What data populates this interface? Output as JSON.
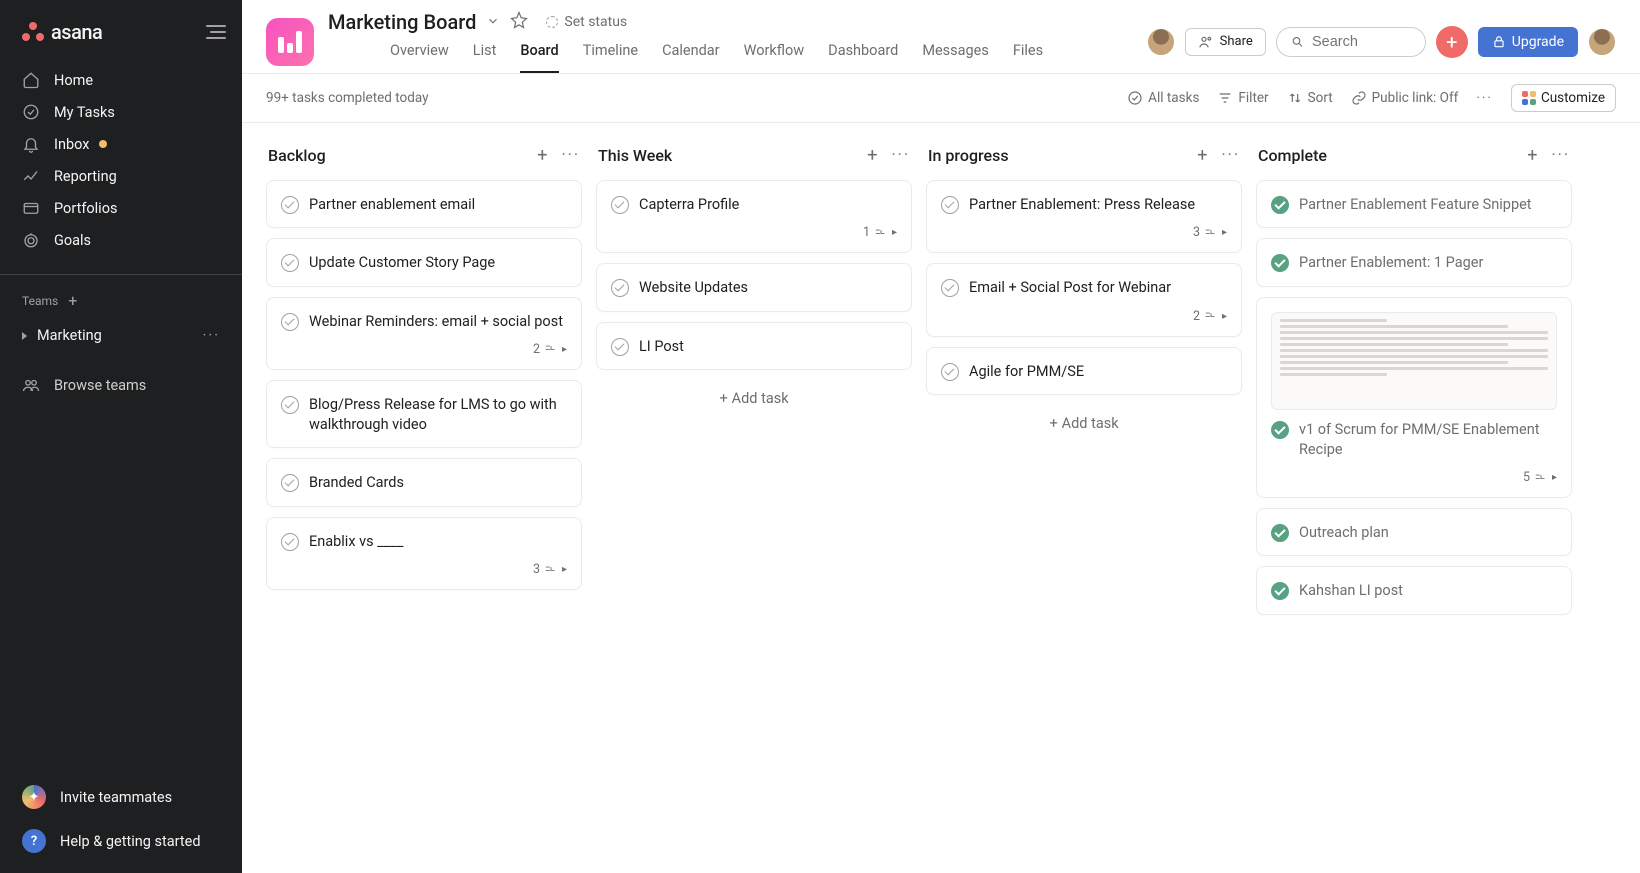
{
  "sidebar": {
    "nav": [
      {
        "label": "Home",
        "icon": "home-icon"
      },
      {
        "label": "My Tasks",
        "icon": "check-circle-icon"
      },
      {
        "label": "Inbox",
        "icon": "bell-icon",
        "dot": true
      },
      {
        "label": "Reporting",
        "icon": "chart-icon"
      },
      {
        "label": "Portfolios",
        "icon": "folder-icon"
      },
      {
        "label": "Goals",
        "icon": "target-icon"
      }
    ],
    "teams_label": "Teams",
    "team_name": "Marketing",
    "browse": "Browse teams",
    "invite": "Invite teammates",
    "help": "Help & getting started"
  },
  "header": {
    "title": "Marketing Board",
    "set_status": "Set status",
    "share": "Share",
    "search_placeholder": "Search",
    "upgrade": "Upgrade",
    "tabs": [
      "Overview",
      "List",
      "Board",
      "Timeline",
      "Calendar",
      "Workflow",
      "Dashboard",
      "Messages",
      "Files"
    ],
    "active_tab": "Board"
  },
  "toolbar": {
    "completed_text": "99+ tasks completed today",
    "all_tasks": "All tasks",
    "filter": "Filter",
    "sort": "Sort",
    "public": "Public link: Off",
    "customize": "Customize"
  },
  "columns": [
    {
      "name": "Backlog",
      "cards": [
        {
          "title": "Partner enablement email",
          "done": false
        },
        {
          "title": "Update Customer Story Page",
          "done": false
        },
        {
          "title": "Webinar Reminders: email + social post",
          "done": false,
          "subtasks": 2
        },
        {
          "title": "Blog/Press Release for LMS to go with walkthrough video",
          "done": false
        },
        {
          "title": "Branded Cards",
          "done": false
        },
        {
          "title": "Enablix vs ____",
          "done": false,
          "subtasks": 3
        }
      ]
    },
    {
      "name": "This Week",
      "cards": [
        {
          "title": "Capterra Profile",
          "done": false,
          "subtasks": 1
        },
        {
          "title": "Website Updates",
          "done": false
        },
        {
          "title": "LI Post",
          "done": false
        }
      ],
      "show_add": true
    },
    {
      "name": "In progress",
      "cards": [
        {
          "title": "Partner Enablement: Press Release",
          "done": false,
          "subtasks": 3
        },
        {
          "title": "Email + Social Post for Webinar",
          "done": false,
          "subtasks": 2
        },
        {
          "title": "Agile for PMM/SE",
          "done": false
        }
      ],
      "show_add": true
    },
    {
      "name": "Complete",
      "cards": [
        {
          "title": "Partner Enablement Feature Snippet",
          "done": true
        },
        {
          "title": "Partner Enablement: 1 Pager",
          "done": true
        },
        {
          "title": "v1 of Scrum for PMM/SE Enablement Recipe",
          "done": true,
          "subtasks": 5,
          "image": true
        },
        {
          "title": "Outreach plan",
          "done": true
        },
        {
          "title": "Kahshan LI post",
          "done": true
        }
      ]
    }
  ],
  "add_task_label": "Add task"
}
